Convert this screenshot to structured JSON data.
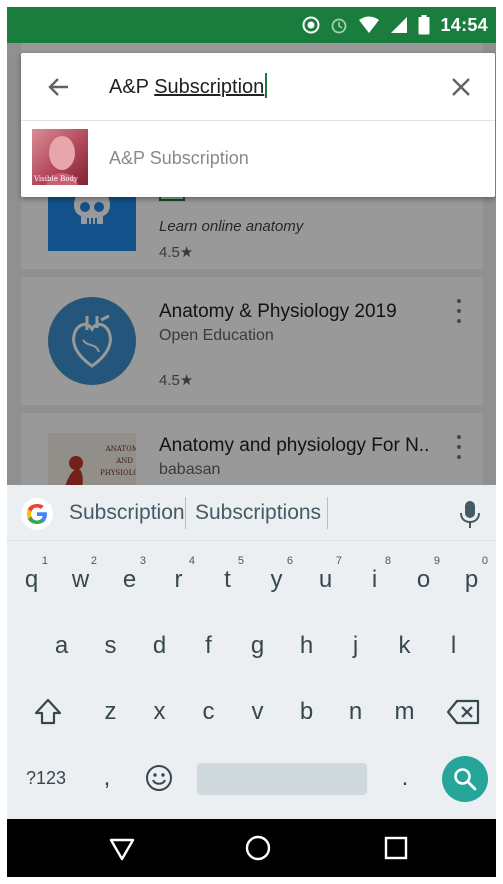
{
  "status_bar": {
    "time": "14:54",
    "icons": [
      "sync-icon",
      "alarm-icon",
      "wifi-icon",
      "signal-icon",
      "battery-icon"
    ]
  },
  "search": {
    "query_prefix": "A&P ",
    "query_composing": "Subscription",
    "back_icon": "arrow-back-icon",
    "clear_icon": "close-icon",
    "suggestion": {
      "label": "A&P Subscription",
      "thumb_caption": "Visible Body"
    }
  },
  "results": [
    {
      "tagline": "Learn online anatomy",
      "rating": "4.5★",
      "icon": "skull-icon"
    },
    {
      "title": "Anatomy & Physiology 2019",
      "developer": "Open Education",
      "rating": "4.5★",
      "icon": "heart-icon"
    },
    {
      "title": "Anatomy and physiology For N..",
      "developer": "babasan",
      "icon": "book-cover-icon",
      "cover_lines": [
        "ANATOMY",
        "AND",
        "PHYSIOLOGY"
      ]
    }
  ],
  "keyboard": {
    "suggestions": [
      "Subscription",
      "Subscriptions"
    ],
    "row1": [
      "q",
      "w",
      "e",
      "r",
      "t",
      "y",
      "u",
      "i",
      "o",
      "p"
    ],
    "row1_hints": [
      "1",
      "2",
      "3",
      "4",
      "5",
      "6",
      "7",
      "8",
      "9",
      "0"
    ],
    "row2": [
      "a",
      "s",
      "d",
      "f",
      "g",
      "h",
      "j",
      "k",
      "l"
    ],
    "row3": [
      "z",
      "x",
      "c",
      "v",
      "b",
      "n",
      "m"
    ],
    "symbols_key": "?123",
    "comma_key": ",",
    "period_key": "."
  },
  "colors": {
    "status_bar": "#1a7d3d",
    "search_key": "#26a69a",
    "caret": "#1a7d3d"
  }
}
